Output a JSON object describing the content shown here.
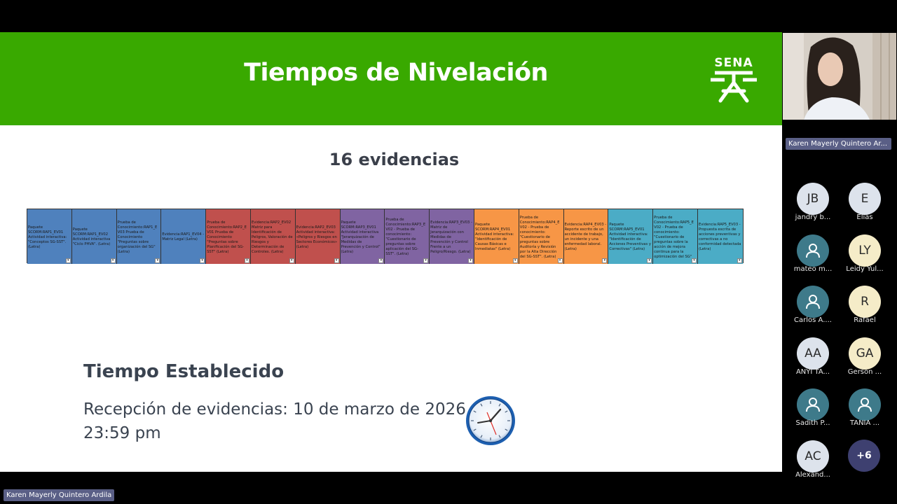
{
  "slide": {
    "title": "Tiempos de Nivelación",
    "logo_text": "SENA",
    "subtitle": "16 evidencias",
    "section_title": "Tiempo Establecido",
    "reception_line1": "Recepción de evidencias: 10 de marzo de 2026",
    "reception_line2": "23:59 pm",
    "header_color": "#39a900",
    "evidences": [
      {
        "text": "Paquete SCORM:RAP1_EV01 Actividad interactiva: \"Conceptos SG-SST\". (Letra)",
        "color": "#4f81bd"
      },
      {
        "text": "Paquete SCORM:RAP1_EV02 Actividad interactiva \"Ciclo PHVA\". (Letra)",
        "color": "#4f81bd"
      },
      {
        "text": "Prueba de Conocimiento:RAP1_E V03 Prueba de Conocimiento \"Preguntas sobre organización del SG\" (Letra)",
        "color": "#4f81bd"
      },
      {
        "text": "Evidencia:RAP1_EV04 - Matriz Legal (Letra)",
        "color": "#4f81bd"
      },
      {
        "text": "Prueba de Conocimiento:RAP2_E V01 Prueba de Conocimiento \"Preguntas sobre Planificación del SG-SST\" (Letra)",
        "color": "#c0504d"
      },
      {
        "text": "Evidencia:RAP2_EV02 Matriz para Identificación de Peligros, Valoración de Riesgos y Determinación de Controles. (Letra)",
        "color": "#c0504d"
      },
      {
        "text": "Evidencia:RAP2_EV03 Actividad interactiva: «Peligros y Riesgos en Sectores Económicos» (Letra)",
        "color": "#c0504d"
      },
      {
        "text": "Paquete SCORM:RAP3_EV01 Actividad interactiva \"Jerarquización de Medidas de Prevención y Control\" (Letra)",
        "color": "#8064a2"
      },
      {
        "text": "Prueba de Conocimiento:RAP3_E V02 - Prueba de conocimiento: \"Cuestionario de preguntas sobre aplicación del SG-SST\". (Letra)",
        "color": "#8064a2"
      },
      {
        "text": "Evidencia:RAP3_EV03 - Matriz de Jerarquización con Medidas de Prevención y Control Frente a un Peligro/Riesgo. (Letra)",
        "color": "#8064a2"
      },
      {
        "text": "Paquete SCORM:RAP4_EV01 Actividad interactiva: \"Identificación de Causas Básicas e Inmediatas\" (Letra)",
        "color": "#f79646"
      },
      {
        "text": "Prueba de Conocimiento:RAP4_E V02 - Prueba de conocimiento: \"Cuestionario de preguntas sobre Auditoría y Revisión por la Alta Dirección del SG-SST\". (Letra)",
        "color": "#f79646"
      },
      {
        "text": "Evidencia:RAP4_EV03 - Reporte escrito de un accidente de trabajo, un incidente y una enfermedad laboral. (Letra)",
        "color": "#f79646"
      },
      {
        "text": "Paquete SCORM:RAP5_EV01 Actividad interactiva: \"Identificación de Acciones Preventivas y Correctivas\" (Letra)",
        "color": "#4bacc6"
      },
      {
        "text": "Prueba de Conocimiento:RAP5_E V02 - Prueba de conocimiento: \"Cuestionario de preguntas sobre la acción de mejora continua para la optimización del SG\"",
        "color": "#4bacc6"
      },
      {
        "text": "Evidencia:RAP5_EV03 - Propuesta escrita de acciones preventivas y correctivas a no conformidad detectada (Letra)",
        "color": "#4bacc6"
      }
    ]
  },
  "sidebar": {
    "presenter_name": "Karen Mayerly Quintero Ar...",
    "more_count": "+6",
    "participants": [
      {
        "initials": "JB",
        "name": "jandry b...",
        "bg": "#dde3ec",
        "icon": ""
      },
      {
        "initials": "E",
        "name": "Elías",
        "bg": "#dde3ec",
        "icon": ""
      },
      {
        "initials": "",
        "name": "mateo m...",
        "bg": "#3e7a8a",
        "icon": "person-icon"
      },
      {
        "initials": "LY",
        "name": "Leidy Yul...",
        "bg": "#f5ecc8",
        "icon": ""
      },
      {
        "initials": "",
        "name": "Carlos A....",
        "bg": "#3e7a8a",
        "icon": "person-icon"
      },
      {
        "initials": "R",
        "name": "Rafael",
        "bg": "#f5ecc8",
        "icon": ""
      },
      {
        "initials": "AA",
        "name": "ANYI TA...",
        "bg": "#dde3ec",
        "icon": ""
      },
      {
        "initials": "GA",
        "name": "Gerson ...",
        "bg": "#f5ecc8",
        "icon": ""
      },
      {
        "initials": "",
        "name": "Sadith P...",
        "bg": "#3e7a8a",
        "icon": "person-icon"
      },
      {
        "initials": "",
        "name": "TANIA ...",
        "bg": "#3e7a8a",
        "icon": "person-icon"
      },
      {
        "initials": "AC",
        "name": "Alexand...",
        "bg": "#dde3ec",
        "icon": ""
      }
    ]
  },
  "footer": {
    "presenter_label": "Karen Mayerly Quintero Ardila"
  }
}
